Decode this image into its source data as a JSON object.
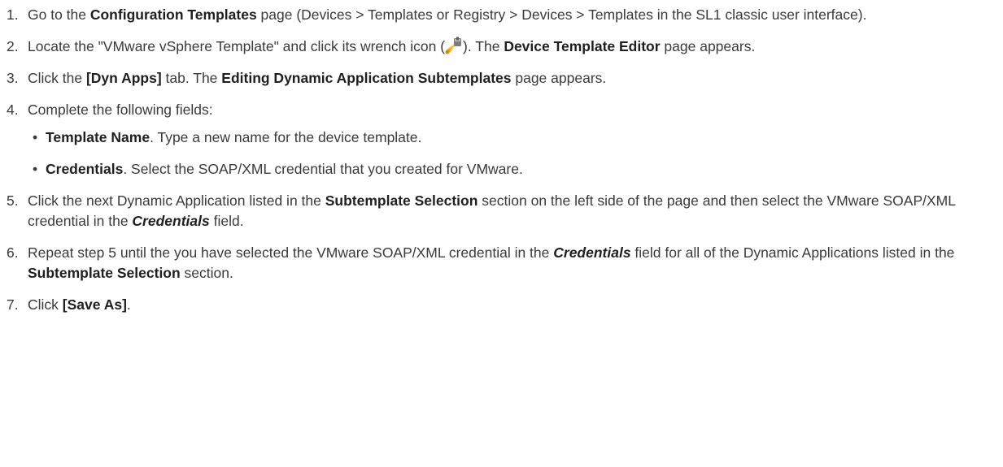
{
  "steps": [
    {
      "num": "1.",
      "t1": "Go to the ",
      "b1": "Configuration Templates",
      "t2": " page (Devices > Templates or Registry > Devices > Templates in the SL1 classic user interface)."
    },
    {
      "num": "2.",
      "t1": "Locate the \"VMware vSphere Template\" and click its wrench icon (",
      "icon": "wrench-icon",
      "t2": "). The ",
      "b1": "Device Template Editor",
      "t3": " page appears."
    },
    {
      "num": "3.",
      "t1": "Click the ",
      "b1": "[Dyn Apps]",
      "t2": " tab. The ",
      "b2": "Editing Dynamic Application Subtemplates",
      "t3": " page appears."
    },
    {
      "num": "4.",
      "t1": "Complete the following fields:",
      "bullets": [
        {
          "b": "Template Name",
          "t": ". Type a new name for the device template."
        },
        {
          "b": "Credentials",
          "t": ". Select the SOAP/XML credential that you created for VMware."
        }
      ]
    },
    {
      "num": "5.",
      "t1": "Click the next Dynamic Application listed in the ",
      "b1": "Subtemplate Selection",
      "t2": " section on the left side of the page and then select the VMware SOAP/XML credential in the ",
      "bi1": "Credentials",
      "t3": " field."
    },
    {
      "num": "6.",
      "t1": "Repeat step 5 until the you have selected the VMware SOAP/XML credential in the ",
      "bi1": "Credentials",
      "t2": " field for all of the Dynamic Applications listed in the ",
      "b1": "Subtemplate Selection",
      "t3": " section."
    },
    {
      "num": "7.",
      "t1": "Click ",
      "b1": "[Save As]",
      "t2": "."
    }
  ],
  "bullet_char": "•"
}
